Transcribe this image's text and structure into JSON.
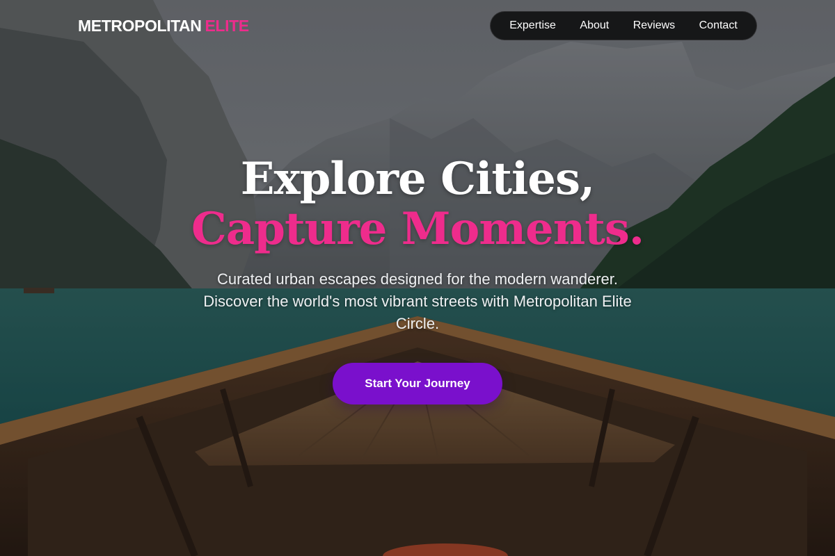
{
  "brand": {
    "name_main": "METROPOLITAN",
    "name_accent": "ELITE",
    "accent_color": "#ee2c8c"
  },
  "nav": {
    "items": [
      {
        "label": "Expertise"
      },
      {
        "label": "About"
      },
      {
        "label": "Reviews"
      },
      {
        "label": "Contact"
      }
    ]
  },
  "hero": {
    "headline_line1": "Explore Cities,",
    "headline_line2": "Capture Moments.",
    "subtitle": "Curated urban escapes designed for the modern wanderer. Discover the world's most vibrant streets with Metropolitan Elite Circle.",
    "cta_label": "Start Your Journey",
    "cta_color": "#7a10cc",
    "background_image": "mountain-lake-rowboat-photo"
  }
}
